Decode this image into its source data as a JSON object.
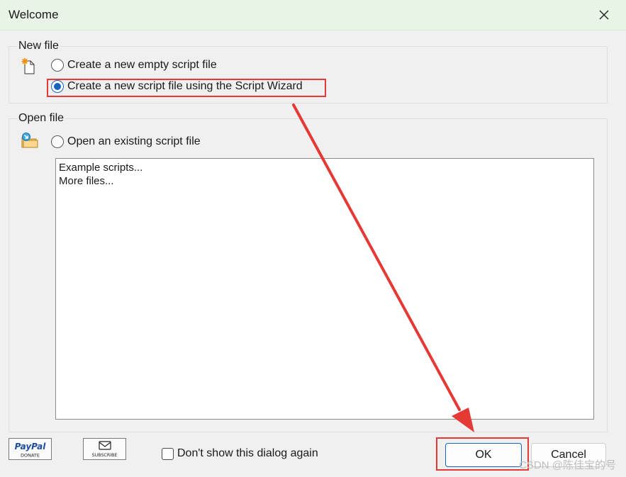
{
  "window": {
    "title": "Welcome",
    "close_icon": "close-icon"
  },
  "new_file": {
    "legend": "New file",
    "icon": "new-file-icon",
    "options": [
      {
        "label": "Create a new empty script file",
        "checked": false
      },
      {
        "label": "Create a new script file using the Script Wizard",
        "checked": true
      }
    ]
  },
  "open_file": {
    "legend": "Open file",
    "icon": "open-folder-icon",
    "option": {
      "label": "Open an existing script file",
      "checked": false
    },
    "list_items": [
      "Example scripts...",
      "More files..."
    ]
  },
  "footer": {
    "paypal": {
      "brand": "PayPal",
      "sub": "DONATE"
    },
    "subscribe": {
      "label": "SUBSCRIBE",
      "icon": "envelope-icon"
    },
    "dont_show_label": "Don't show this dialog again",
    "dont_show_checked": false,
    "ok_label": "OK",
    "cancel_label": "Cancel"
  },
  "annotations": {
    "highlight_color": "#e53935",
    "arrow_color": "#e53935"
  },
  "watermark": "CSDN @陈佳宝的号",
  "colors": {
    "titlebar_bg": "#e8f5e6",
    "accent": "#1565c0",
    "dialog_bg": "#f0f0f0"
  }
}
